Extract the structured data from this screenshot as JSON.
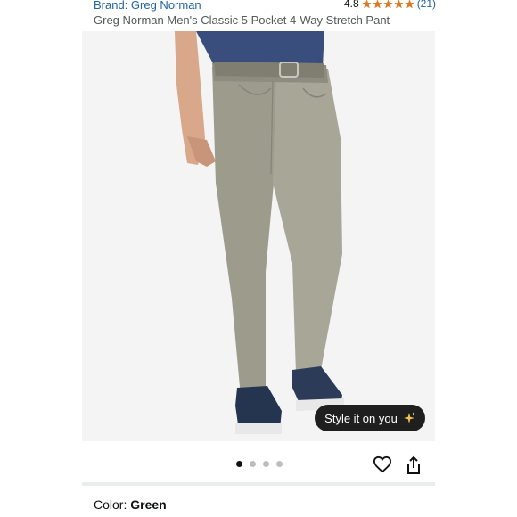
{
  "header": {
    "brand": "Brand: Greg Norman",
    "rating_value": "4.8",
    "rating_stars": 4.8,
    "rating_count": "(21)",
    "title": "Greg Norman Men's Classic 5 Pocket 4-Way Stretch Pant"
  },
  "gallery": {
    "style_button_label": "Style it on you",
    "total_images": 4,
    "active_index": 0
  },
  "actions": {
    "heart_icon": "heart-outline-icon",
    "share_icon": "share-icon"
  },
  "variant": {
    "label": "Color: ",
    "value": "Green"
  },
  "colors": {
    "link": "#2162a1",
    "star": "#de7921",
    "pant": "#9c9b8c",
    "shirt": "#3a4e7d"
  }
}
